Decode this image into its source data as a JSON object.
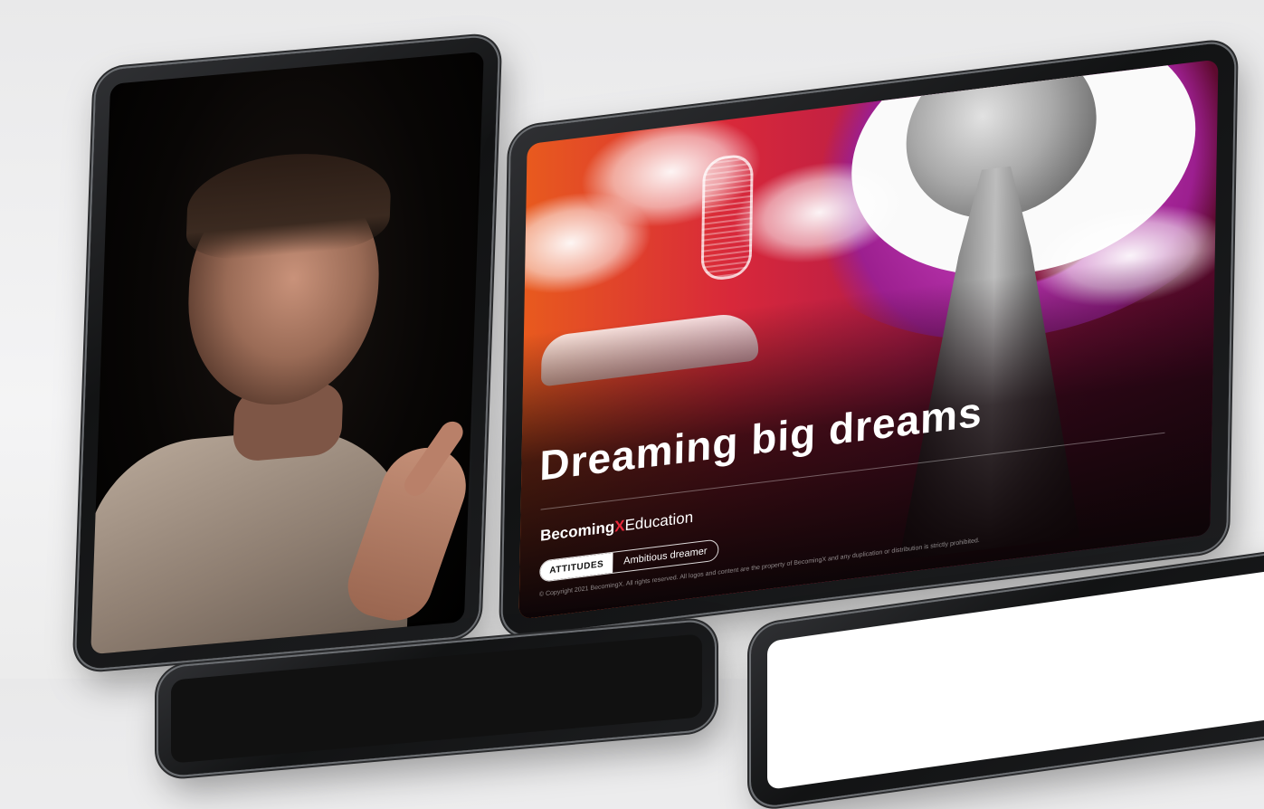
{
  "main_slide": {
    "title": "Dreaming big dreams",
    "brand_bold": "Becoming",
    "brand_x": "X",
    "brand_regular": "Education",
    "tag_category": "ATTITUDES",
    "tag_value": "Ambitious dreamer",
    "copyright": "© Copyright 2021 BecomingX. All rights reserved. All logos and content are the property of BecomingX and any duplication or distribution is strictly prohibited."
  },
  "colors": {
    "accent_red": "#e8283a",
    "gradient_orange": "#e85a1e",
    "gradient_magenta": "#b02ea4",
    "device_frame": "#1c1d1f"
  }
}
